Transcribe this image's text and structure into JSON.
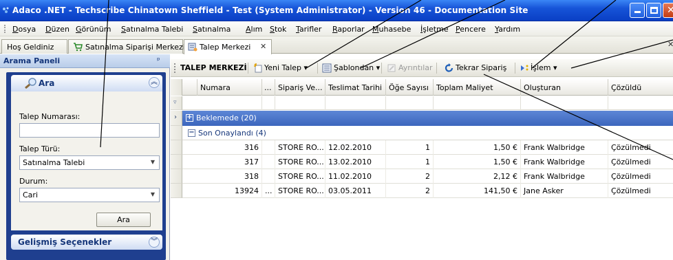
{
  "window": {
    "title": "Adaco .NET - Techscribe Chinatown Sheffield - Test (System Administrator) - Version 46 - Documentation Site",
    "colors": {
      "titlebar": "#1654d8",
      "accent": "#15367a",
      "selected_row": "#4a74c9"
    }
  },
  "menu": {
    "items": [
      "Dosya",
      "Düzen",
      "Görünüm",
      "Satınalma Talebi",
      "Satınalma",
      "Alım",
      "Stok",
      "Tarifler",
      "Raporlar",
      "Muhasebe",
      "İşletme",
      "Pencere",
      "Yardım"
    ]
  },
  "tabs": [
    {
      "label": "Hoş Geldiniz",
      "icon": "none"
    },
    {
      "label": "Satınalma Siparişi Merkezi",
      "icon": "cart-icon"
    },
    {
      "label": "Talep Merkezi",
      "icon": "requisition-icon",
      "active": true
    }
  ],
  "search_panel": {
    "title": "Arama Paneli",
    "group_title": "Ara",
    "talep_numarasi_label": "Talep Numarası:",
    "talep_numarasi_value": "",
    "talep_turu_label": "Talep Türü:",
    "talep_turu_value": "Satınalma Talebi",
    "durum_label": "Durum:",
    "durum_value": "Cari",
    "search_button": "Ara",
    "advanced_title": "Gelişmiş Seçenekler"
  },
  "toolbar": {
    "title": "TALEP MERKEZİ",
    "new_request": "Yeni Talep",
    "from_template": "Şablondan",
    "details": "Ayrıntılar",
    "reorder": "Tekrar Sipariş",
    "action": "İşlem"
  },
  "grid": {
    "columns": [
      "Numara",
      "...",
      "Sipariş Ve...",
      "Teslimat Tarihi",
      "Öğe Sayısı",
      "Toplam Maliyet",
      "Oluşturan",
      "Çözüldü"
    ],
    "groups": [
      {
        "label": "Beklemede (20)",
        "expanded": false,
        "selected": true
      },
      {
        "label": "Son Onaylandı (4)",
        "expanded": true,
        "selected": false
      }
    ],
    "rows": [
      {
        "numara": "316",
        "dots": "",
        "siparis": "STORE RO...",
        "teslimat": "12.02.2010",
        "oge": "1",
        "maliyet": "1,50 €",
        "olusturan": "Frank Walbridge",
        "cozuldu": "Çözülmedi"
      },
      {
        "numara": "317",
        "dots": "",
        "siparis": "STORE RO...",
        "teslimat": "13.02.2010",
        "oge": "1",
        "maliyet": "1,50 €",
        "olusturan": "Frank Walbridge",
        "cozuldu": "Çözülmedi"
      },
      {
        "numara": "318",
        "dots": "",
        "siparis": "STORE RO...",
        "teslimat": "11.02.2010",
        "oge": "2",
        "maliyet": "2,12 €",
        "olusturan": "Frank Walbridge",
        "cozuldu": "Çözülmedi"
      },
      {
        "numara": "13924",
        "dots": "...",
        "siparis": "STORE RO...",
        "teslimat": "03.05.2011",
        "oge": "2",
        "maliyet": "141,50 €",
        "olusturan": "Jane Asker",
        "cozuldu": "Çözülmedi"
      }
    ]
  }
}
